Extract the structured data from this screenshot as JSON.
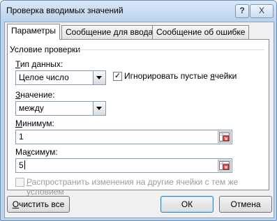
{
  "window": {
    "title": "Проверка вводимых значений",
    "help_glyph": "?",
    "close_glyph": "X"
  },
  "tabs": [
    {
      "label": "Параметры",
      "selected": true
    },
    {
      "label": "Сообщение для ввода",
      "selected": false
    },
    {
      "label": "Сообщение об ошибке",
      "selected": false
    }
  ],
  "settings": {
    "group_title": "Условие проверки",
    "data_type": {
      "label_pre": "",
      "label_key": "Т",
      "label_post": "ип данных:",
      "value": "Целое число"
    },
    "ignore_blank": {
      "label_pre": "Игнорировать пустые ",
      "label_key": "я",
      "label_post": "чейки",
      "checked": true,
      "check_glyph": "✓"
    },
    "operator": {
      "label_pre": "",
      "label_key": "З",
      "label_post": "начение:",
      "value": "между"
    },
    "minimum": {
      "label_pre": "",
      "label_key": "М",
      "label_post": "инимум:",
      "value": "1"
    },
    "maximum": {
      "label_pre": "Ма",
      "label_key": "к",
      "label_post": "симум:",
      "value": "5"
    },
    "apply_all": {
      "label_pre": "",
      "label_key": "Р",
      "label_post": "аспространить изменения на другие ячейки с тем же условием",
      "checked": false,
      "enabled": false
    }
  },
  "buttons": {
    "clear_all": {
      "pre": "",
      "key": "О",
      "post": "чистить все"
    },
    "ok": "ОК",
    "cancel": "Отмена"
  },
  "icons": {
    "range_select": "collapse-dialog-icon"
  },
  "colors": {
    "accent_red": "#c0392b",
    "frame": "#bcd3ec",
    "disabled_text": "#9b9b9b"
  }
}
